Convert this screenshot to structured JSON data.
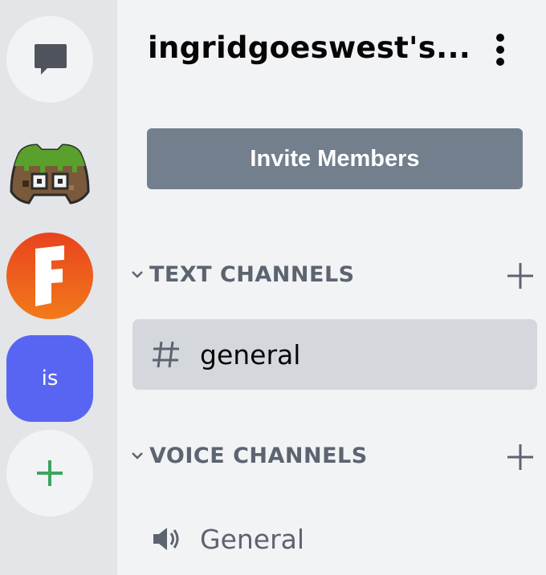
{
  "server_rail": {
    "dm_icon": "chat-bubble-icon",
    "servers": [
      {
        "name": "minecraft-server",
        "icon": "minecraft-creeper-icon"
      },
      {
        "name": "fortnite-server",
        "icon": "fortnite-f-icon",
        "letter": "F",
        "color": "#e8431e"
      },
      {
        "name": "is-server",
        "label": "is",
        "color": "#5865f2"
      }
    ],
    "add_icon": "plus-icon",
    "add_color": "#3ba55d"
  },
  "sidebar": {
    "server_name": "ingridgoeswest's...",
    "menu_icon": "more-vertical-icon",
    "invite_label": "Invite Members",
    "invite_color": "#747f8d",
    "categories": [
      {
        "label": "TEXT CHANNELS",
        "channels": [
          {
            "name": "general",
            "icon": "hashtag-icon",
            "selected": true
          }
        ]
      },
      {
        "label": "VOICE CHANNELS",
        "channels": [
          {
            "name": "General",
            "icon": "speaker-icon",
            "selected": false
          }
        ]
      }
    ]
  }
}
